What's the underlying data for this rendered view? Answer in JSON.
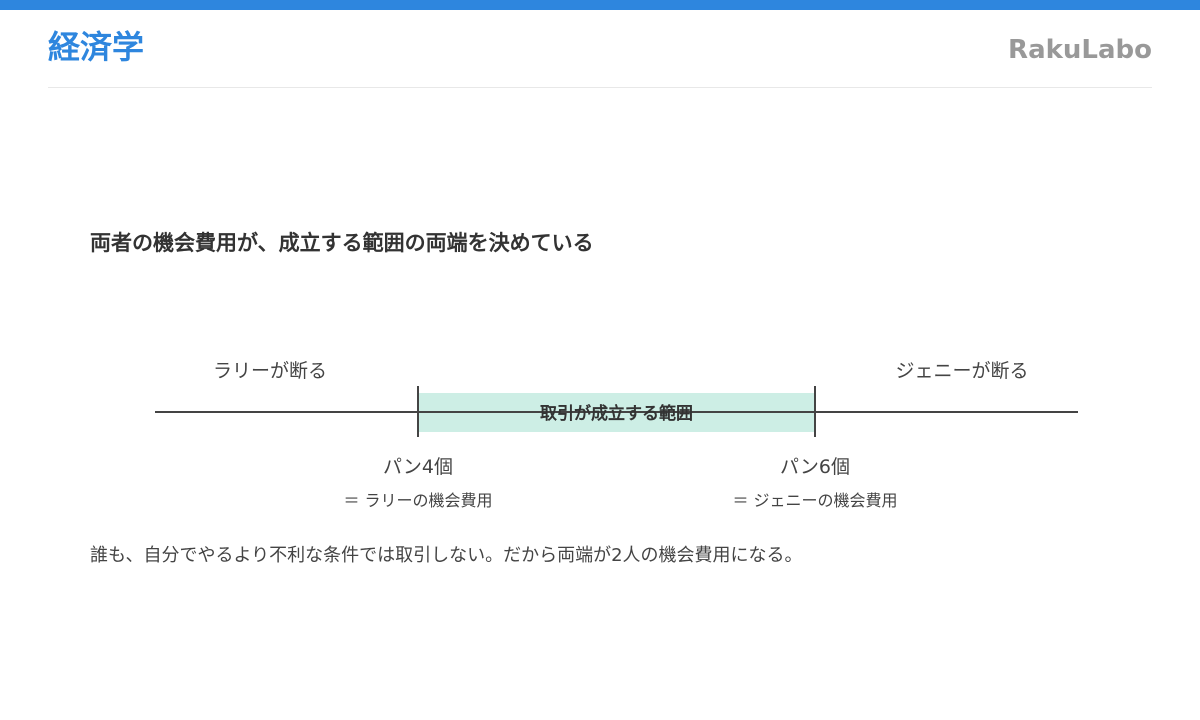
{
  "header": {
    "title": "経済学",
    "brand": "RakuLabo"
  },
  "accent_color": "#2e86de",
  "zone_color": "#cdeee5",
  "heading": "両者の機会費用が、成立する範囲の両端を決めている",
  "diagram": {
    "left_outside_label": "ラリーが断る",
    "right_outside_label": "ジェニーが断る",
    "zone_label": "取引が成立する範囲",
    "lower_bound": {
      "value": "パン4個",
      "note": "＝ ラリーの機会費用"
    },
    "upper_bound": {
      "value": "パン6個",
      "note": "＝ ジェニーの機会費用"
    }
  },
  "conclusion": "誰も、自分でやるより不利な条件では取引しない。だから両端が2人の機会費用になる。"
}
